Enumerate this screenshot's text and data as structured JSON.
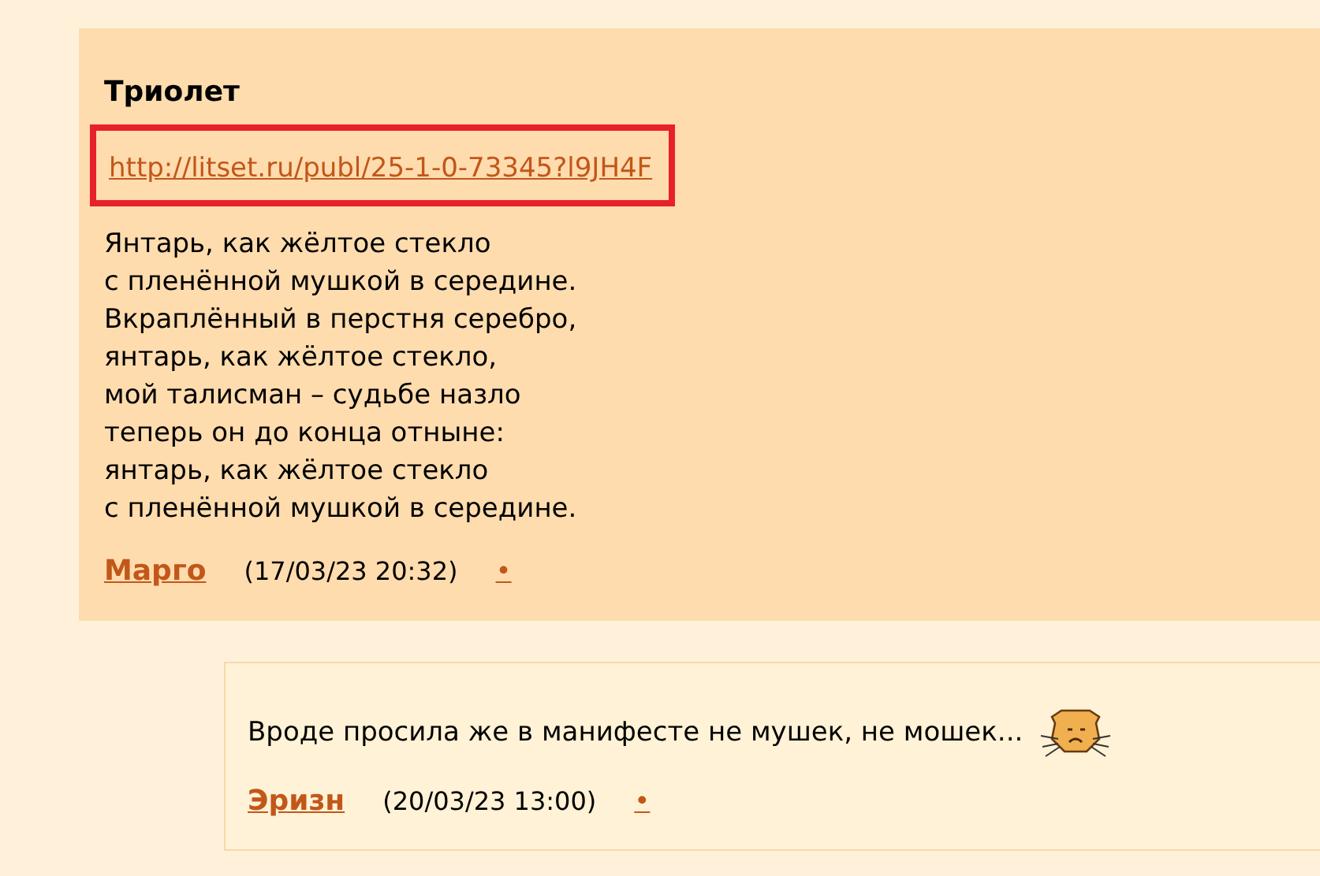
{
  "posts": [
    {
      "title": "Триолет",
      "link": {
        "text": "http://litset.ru/publ/25-1-0-73345?l9JH4F",
        "highlighted": true
      },
      "lines": [
        "Янтарь, как жёлтое стекло",
        "с пленённой мушкой в середине.",
        "Вкраплённый в перстня серебро,",
        "янтарь, как жёлтое стекло,",
        "мой талисман – судьбе назло",
        "теперь он до конца отныне:",
        "янтарь, как жёлтое стекло",
        "с пленённой мушкой в середине."
      ],
      "author": "Марго",
      "date": "(17/03/23 20:32)",
      "marker": "•",
      "nested": false
    },
    {
      "lines": [
        "Вроде просила же в манифесте не мушек, не мошек..."
      ],
      "emoticon": true,
      "author": "Эризн",
      "date": "(20/03/23 13:00)",
      "marker": "•",
      "nested": true
    }
  ]
}
